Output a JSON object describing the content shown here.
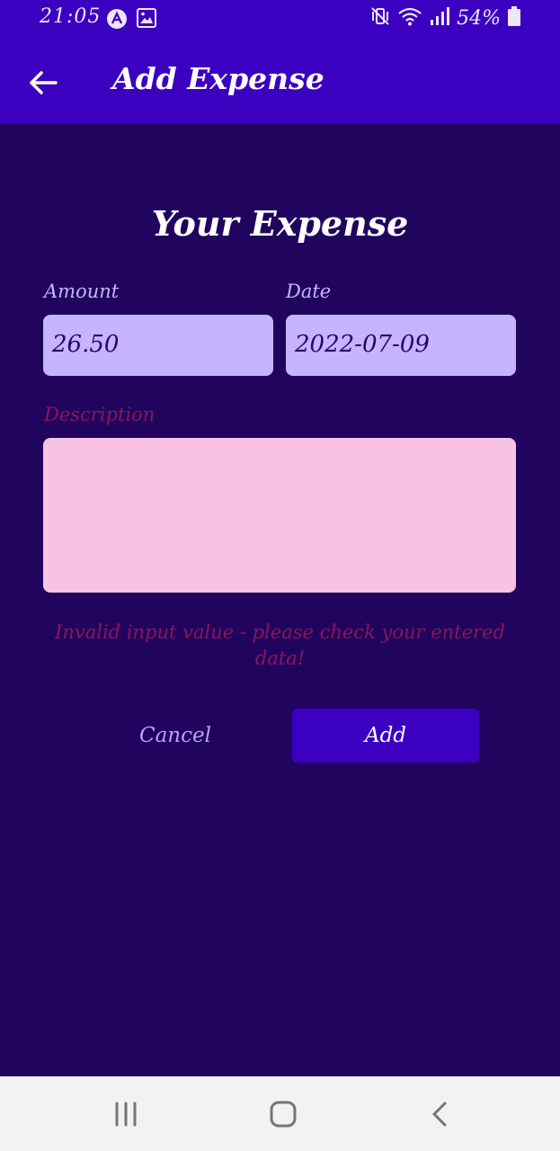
{
  "status_bar": {
    "time": "21:05",
    "battery_percent": "54%",
    "icons": [
      "app-notification-icon",
      "image-notification-icon",
      "mute-vibrate-icon",
      "wifi-icon",
      "signal-icon",
      "battery-icon"
    ]
  },
  "app_bar": {
    "title": "Add Expense",
    "back_icon": "arrow-back-icon"
  },
  "form": {
    "title": "Your Expense",
    "amount": {
      "label": "Amount",
      "value": "26.50"
    },
    "date": {
      "label": "Date",
      "value": "2022-07-09"
    },
    "description": {
      "label": "Description",
      "value": ""
    },
    "error_message": "Invalid input value - please check your entered data!",
    "cancel_label": "Cancel",
    "submit_label": "Add"
  },
  "nav_bar": {
    "icons": [
      "recents-icon",
      "home-icon",
      "back-icon"
    ]
  },
  "colors": {
    "primary": "#3c00c0",
    "background": "#21045e",
    "input_background": "#c6b4ff",
    "invalid_input_background": "#f8c2e3",
    "error": "#8a1757",
    "label": "#c8b4ff"
  }
}
